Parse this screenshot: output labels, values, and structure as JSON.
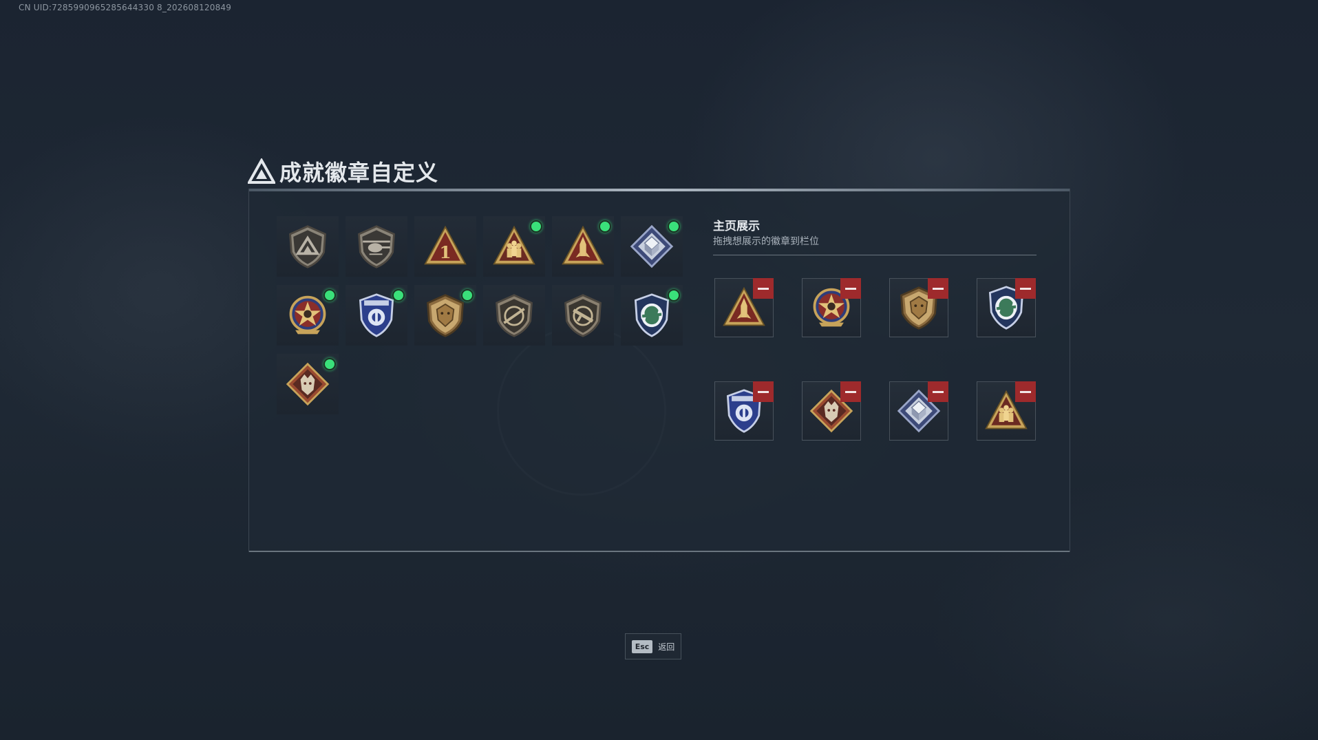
{
  "uid_text": "CN UID:7285990965285644330 8_202608120849",
  "title": "成就徽章自定义",
  "colors": {
    "accent_green": "#3ae07a",
    "remove_red": "#9e2a2c",
    "panel_bg": "#1f2934"
  },
  "badges": [
    {
      "icon": "triangle-shield-badge-icon",
      "new": false
    },
    {
      "icon": "helicopter-shield-badge-icon",
      "new": false
    },
    {
      "icon": "number-one-triangle-badge-icon",
      "new": false
    },
    {
      "icon": "soldiers-triangle-badge-icon",
      "new": true
    },
    {
      "icon": "rocket-triangle-badge-icon",
      "new": true
    },
    {
      "icon": "crystal-diamond-badge-icon",
      "new": true
    },
    {
      "icon": "star-crest-badge-icon",
      "new": true
    },
    {
      "icon": "police-crest-badge-icon",
      "new": true
    },
    {
      "icon": "lion-shield-badge-icon",
      "new": true
    },
    {
      "icon": "sniper-shield-badge-icon",
      "new": false
    },
    {
      "icon": "rifle-shield-badge-icon",
      "new": false
    },
    {
      "icon": "arrows-crest-badge-icon",
      "new": true
    },
    {
      "icon": "wolf-diamond-badge-icon",
      "new": true
    }
  ],
  "showcase": {
    "title": "主页展示",
    "subtitle": "拖拽想展示的徽章到栏位",
    "slots": [
      {
        "icon": "rocket-triangle-badge-icon"
      },
      {
        "icon": "star-crest-badge-icon"
      },
      {
        "icon": "lion-shield-badge-icon"
      },
      {
        "icon": "arrows-crest-badge-icon"
      },
      {
        "icon": "police-crest-badge-icon"
      },
      {
        "icon": "wolf-diamond-badge-icon"
      },
      {
        "icon": "crystal-diamond-badge-icon"
      },
      {
        "icon": "soldiers-triangle-badge-icon"
      }
    ]
  },
  "footer": {
    "esc_key": "Esc",
    "esc_label": "返回"
  }
}
